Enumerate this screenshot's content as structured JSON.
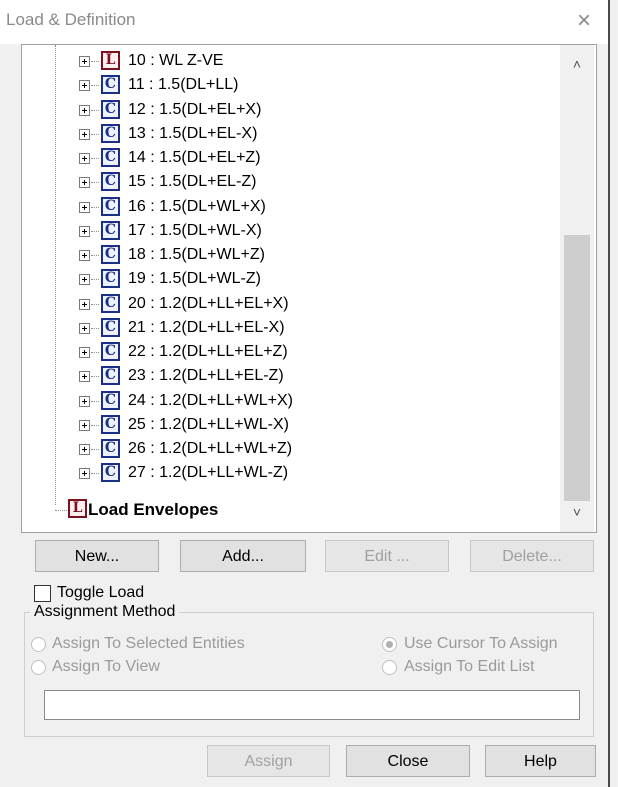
{
  "window": {
    "title": "Load & Definition",
    "close_symbol": "×"
  },
  "tree": {
    "items": [
      {
        "type": "L",
        "label": "10 : WL Z-VE"
      },
      {
        "type": "C",
        "label": "11 : 1.5(DL+LL)"
      },
      {
        "type": "C",
        "label": "12 : 1.5(DL+EL+X)"
      },
      {
        "type": "C",
        "label": "13 : 1.5(DL+EL-X)"
      },
      {
        "type": "C",
        "label": "14 : 1.5(DL+EL+Z)"
      },
      {
        "type": "C",
        "label": "15 : 1.5(DL+EL-Z)"
      },
      {
        "type": "C",
        "label": "16 : 1.5(DL+WL+X)"
      },
      {
        "type": "C",
        "label": "17 : 1.5(DL+WL-X)"
      },
      {
        "type": "C",
        "label": "18 : 1.5(DL+WL+Z)"
      },
      {
        "type": "C",
        "label": "19 : 1.5(DL+WL-Z)"
      },
      {
        "type": "C",
        "label": "20 : 1.2(DL+LL+EL+X)"
      },
      {
        "type": "C",
        "label": "21 : 1.2(DL+LL+EL-X)"
      },
      {
        "type": "C",
        "label": "22 : 1.2(DL+LL+EL+Z)"
      },
      {
        "type": "C",
        "label": "23 : 1.2(DL+LL+EL-Z)"
      },
      {
        "type": "C",
        "label": "24 : 1.2(DL+LL+WL+X)"
      },
      {
        "type": "C",
        "label": "25 : 1.2(DL+LL+WL-X)"
      },
      {
        "type": "C",
        "label": "26 : 1.2(DL+LL+WL+Z)"
      },
      {
        "type": "C",
        "label": "27 : 1.2(DL+LL+WL-Z)"
      }
    ],
    "envelopes": {
      "type": "L",
      "label": "Load Envelopes"
    },
    "scroll_up": "˄",
    "scroll_down": "˅",
    "scroll_position": 0.75
  },
  "buttons": {
    "new": "New...",
    "add": "Add...",
    "edit": "Edit ...",
    "delete": "Delete..."
  },
  "toggle_load": {
    "label": "Toggle Load",
    "checked": false
  },
  "assignment": {
    "group_label": "Assignment Method",
    "options": [
      {
        "label": "Assign To Selected Entities",
        "checked": false
      },
      {
        "label": "Use Cursor To Assign",
        "checked": true
      },
      {
        "label": "Assign To View",
        "checked": false
      },
      {
        "label": "Assign To Edit List",
        "checked": false
      }
    ],
    "field_value": ""
  },
  "footer": {
    "assign": "Assign",
    "close": "Close",
    "help": "Help"
  },
  "colors": {
    "combination_icon": "#1b2f86",
    "load_icon": "#7a1020"
  }
}
